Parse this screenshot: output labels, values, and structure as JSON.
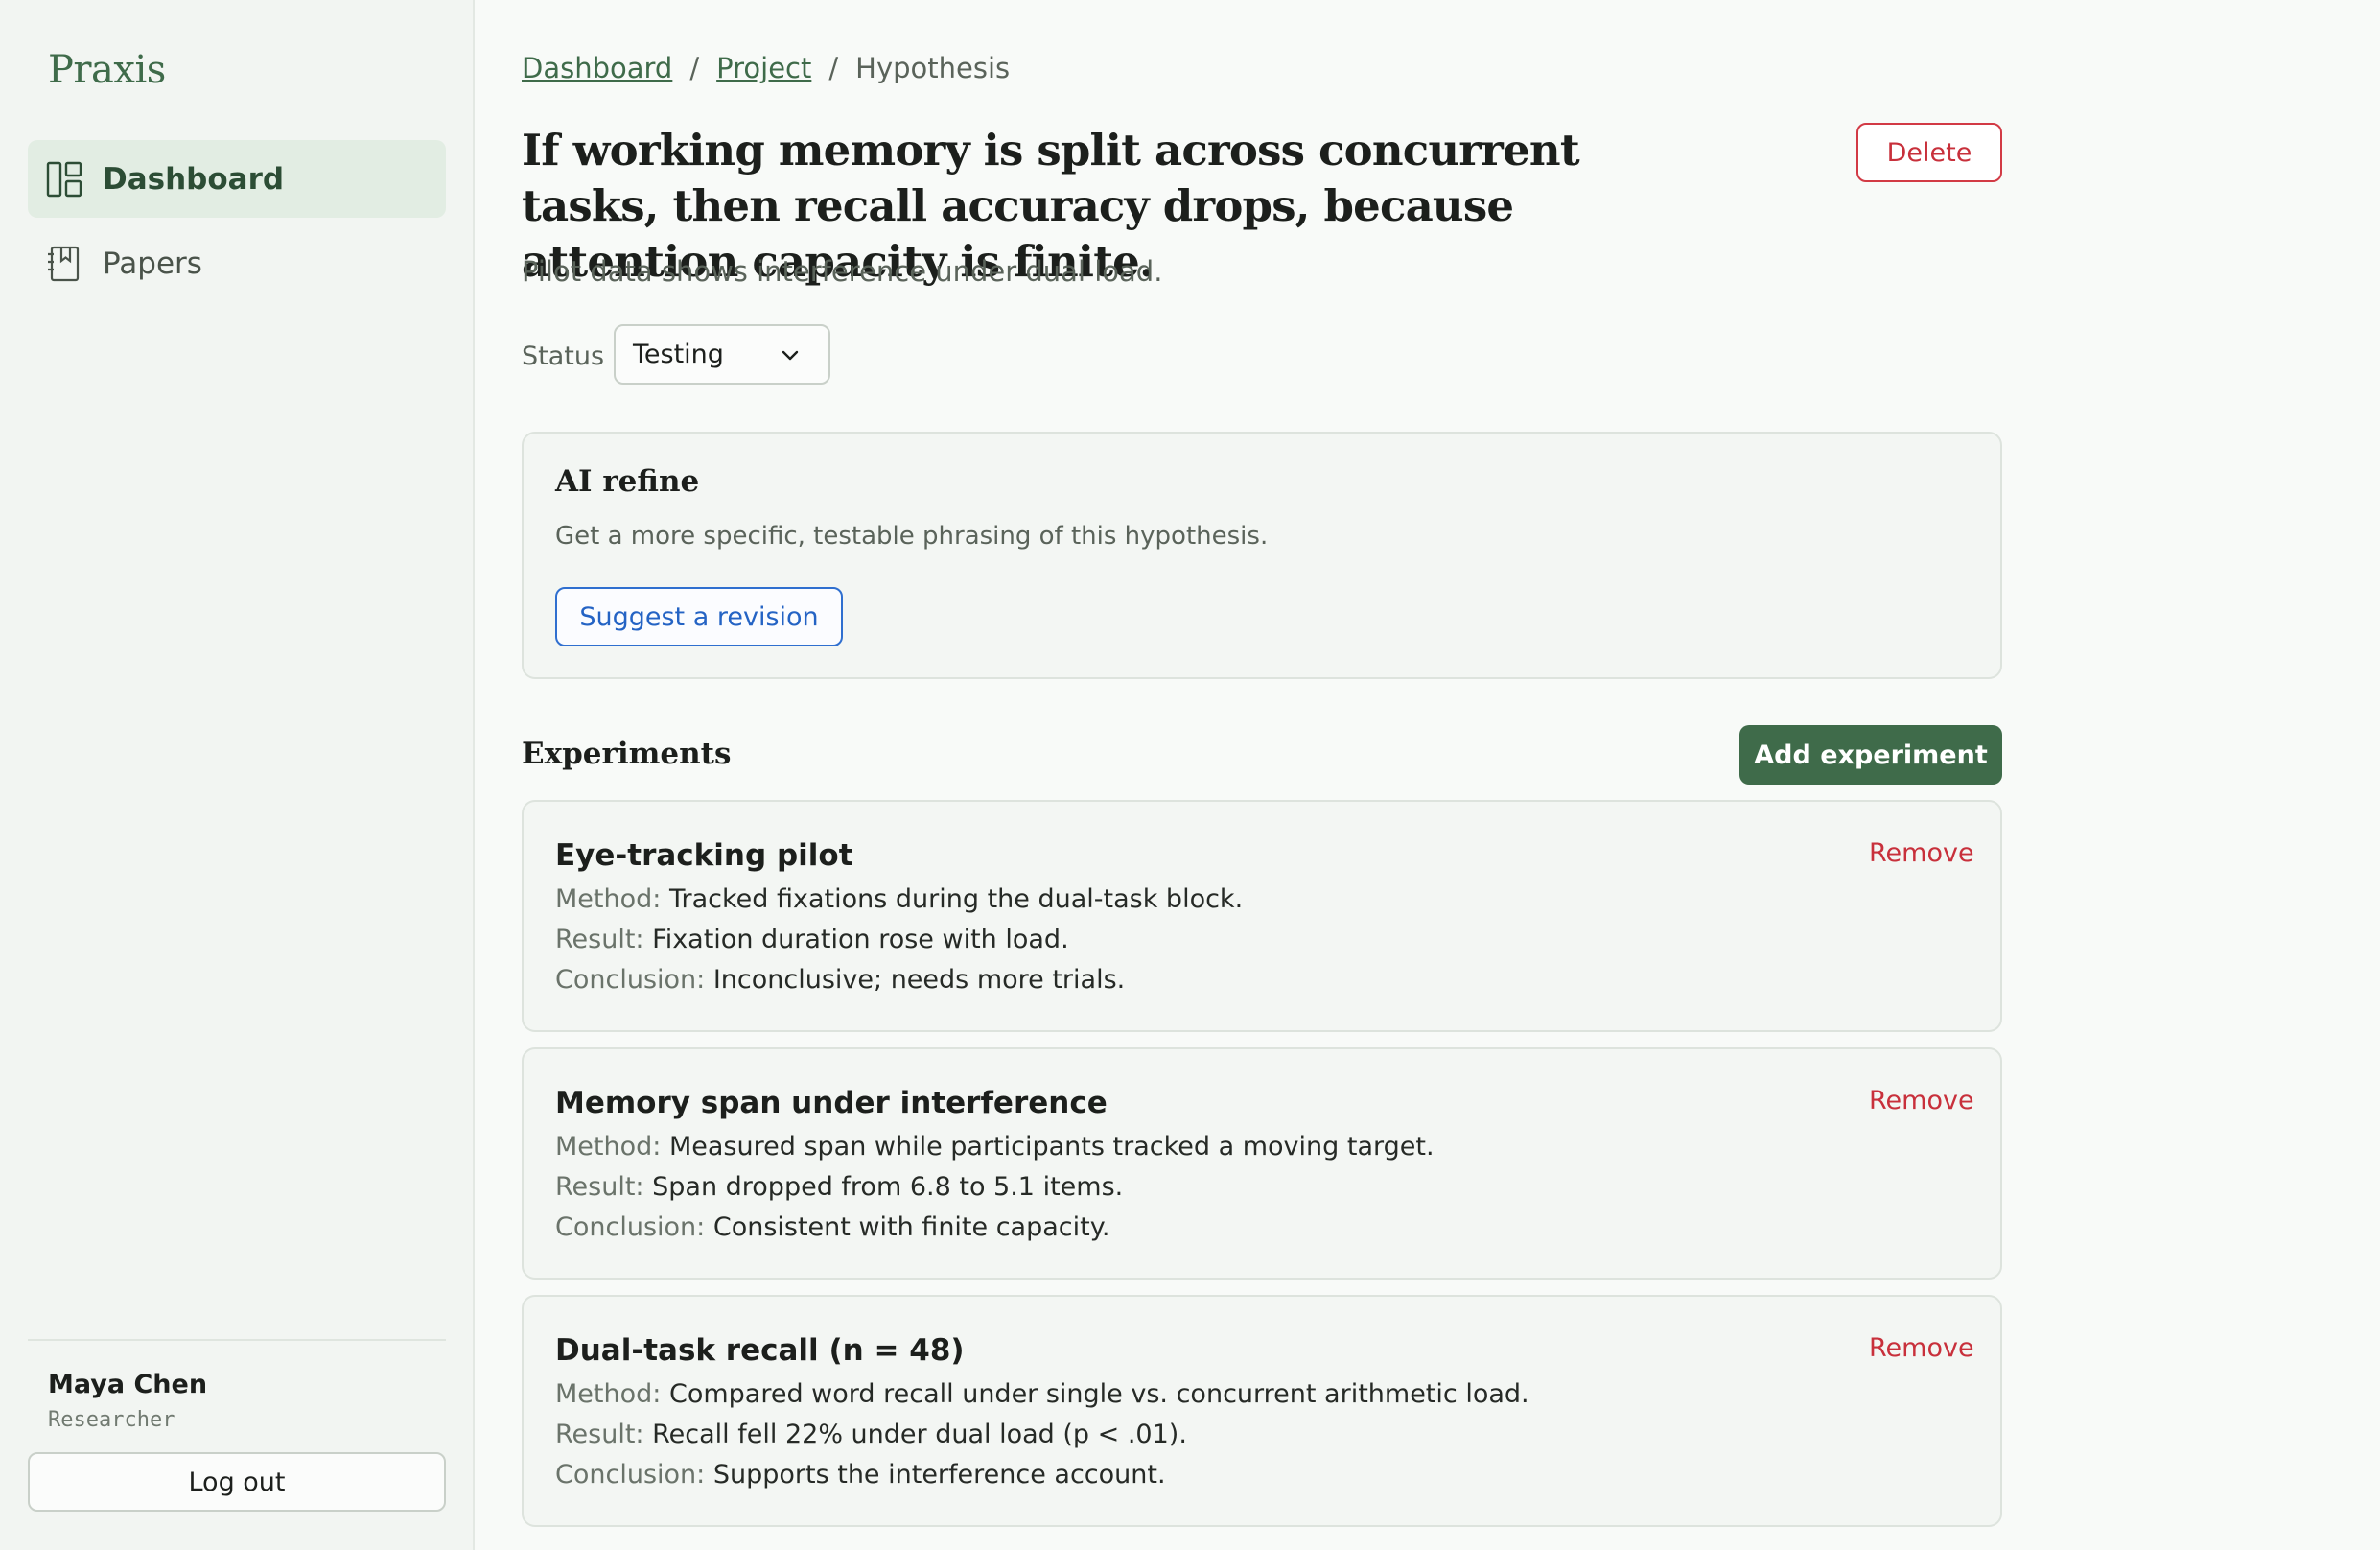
{
  "sidebar": {
    "brand": "Praxis",
    "items": [
      {
        "label": "Dashboard",
        "icon": "layout-dashboard-icon",
        "active": true
      },
      {
        "label": "Papers",
        "icon": "bookmark-book-icon",
        "active": false
      }
    ],
    "user": {
      "name": "Maya Chen",
      "role": "Researcher"
    },
    "logout_label": "Log out"
  },
  "breadcrumb": {
    "items": [
      "Dashboard",
      "Project"
    ],
    "current": "Hypothesis",
    "separator": "/"
  },
  "hypothesis": {
    "title": "If working memory is split across concurrent tasks, then recall accuracy drops, because attention capacity is finite.",
    "subtitle": "Pilot data shows interference under dual load.",
    "delete_label": "Delete",
    "status_label": "Status",
    "status_value": "Testing"
  },
  "ai_refine": {
    "title": "AI refine",
    "description": "Get a more specific, testable phrasing of this hypothesis.",
    "button_label": "Suggest a revision"
  },
  "experiments": {
    "title": "Experiments",
    "add_label": "Add experiment",
    "remove_label": "Remove",
    "method_key": "Method:",
    "result_key": "Result:",
    "conclusion_key": "Conclusion:",
    "items": [
      {
        "title": "Eye-tracking pilot",
        "method": "Tracked fixations during the dual-task block.",
        "result": "Fixation duration rose with load.",
        "conclusion": "Inconclusive; needs more trials."
      },
      {
        "title": "Memory span under interference",
        "method": "Measured span while participants tracked a moving target.",
        "result": "Span dropped from 6.8 to 5.1 items.",
        "conclusion": "Consistent with finite capacity."
      },
      {
        "title": "Dual-task recall (n = 48)",
        "method": "Compared word recall under single vs. concurrent arithmetic load.",
        "result": "Recall fell 22% under dual load (p < .01).",
        "conclusion": "Supports the interference account."
      }
    ]
  },
  "colors": {
    "brand": "#3f6b4a",
    "danger": "#c8303b",
    "link_blue": "#2463c4"
  }
}
